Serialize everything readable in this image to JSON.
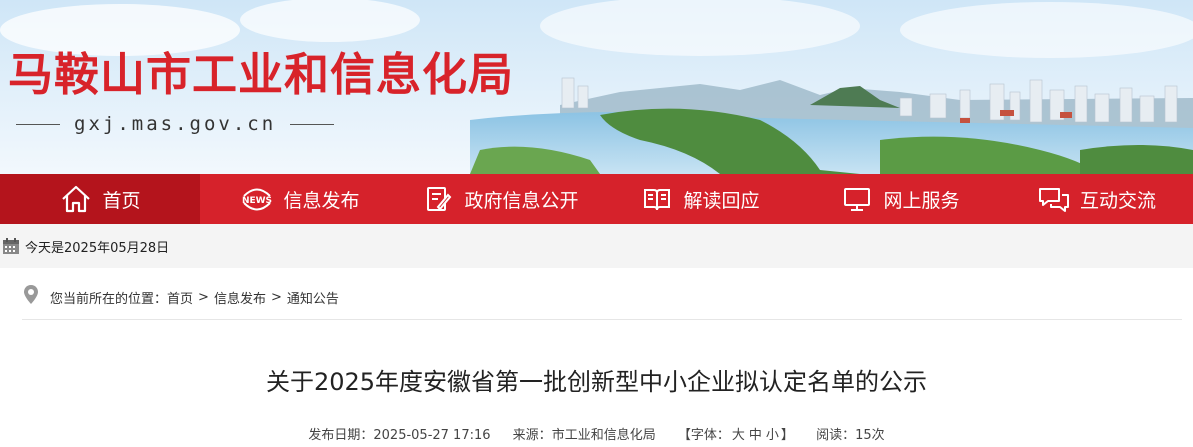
{
  "header": {
    "site_title": "马鞍山市工业和信息化局",
    "site_domain": "gxj.mas.gov.cn"
  },
  "nav": {
    "items": [
      {
        "label": "首页",
        "icon": "home-icon",
        "active": true
      },
      {
        "label": "信息发布",
        "icon": "news-icon",
        "active": false
      },
      {
        "label": "政府信息公开",
        "icon": "document-edit-icon",
        "active": false
      },
      {
        "label": "解读回应",
        "icon": "open-book-icon",
        "active": false
      },
      {
        "label": "网上服务",
        "icon": "monitor-icon",
        "active": false
      },
      {
        "label": "互动交流",
        "icon": "chat-bubbles-icon",
        "active": false
      }
    ]
  },
  "datebar": {
    "today": "今天是2025年05月28日"
  },
  "breadcrumb": {
    "prefix": "您当前所在的位置：",
    "items": [
      "首页",
      "信息发布",
      "通知公告"
    ],
    "separator": ">"
  },
  "article": {
    "title": "关于2025年度安徽省第一批创新型中小企业拟认定名单的公示",
    "publish_label": "发布日期：",
    "publish_date": "2025-05-27 17:16",
    "source_label": "来源：",
    "source": "市工业和信息化局",
    "font_label": "【字体：",
    "font_sizes": [
      "大",
      "中",
      "小"
    ],
    "font_close": "】",
    "views_label": "阅读：",
    "views": "15次"
  },
  "colors": {
    "brand_red": "#d6222b",
    "nav_active": "#b4141c",
    "title_red": "#d8232a"
  }
}
